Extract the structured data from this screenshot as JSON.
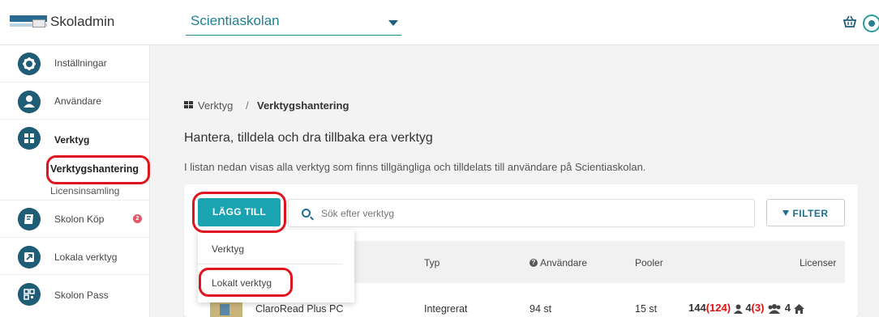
{
  "header": {
    "app_title": "Skoladmin",
    "school_select": "Scientiaskolan"
  },
  "sidebar": {
    "items": [
      {
        "label": "Inställningar",
        "icon": "gear-icon"
      },
      {
        "label": "Användare",
        "icon": "user-icon"
      },
      {
        "label": "Verktyg",
        "icon": "grid-icon"
      },
      {
        "label": "Skolon Köp",
        "icon": "book-icon",
        "badge": "2"
      },
      {
        "label": "Lokala verktyg",
        "icon": "external-link-icon"
      },
      {
        "label": "Skolon Pass",
        "icon": "qr-icon"
      }
    ],
    "subitems": [
      "Verktygshantering",
      "Licensinsamling"
    ]
  },
  "breadcrumb": {
    "parent": "Verktyg",
    "separator": "/",
    "current": "Verktygshantering"
  },
  "main": {
    "heading": "Hantera, tilldela och dra tillbaka era verktyg",
    "description": "I listan nedan visas alla verktyg som finns tillgängliga och tilldelats till användare på Scientiaskolan."
  },
  "toolbar": {
    "add_label": "LÄGG TILL",
    "search_placeholder": "Sök efter verktyg",
    "filter_label": "FILTER"
  },
  "dropdown": {
    "items": [
      "Verktyg",
      "Lokalt verktyg"
    ]
  },
  "table": {
    "columns": [
      "Typ",
      "Användare",
      "Pooler",
      "Licenser"
    ],
    "rows": [
      {
        "name": "ClaroRead Plus PC",
        "type": "Integrerat",
        "users": "94 st",
        "pools": "15 st",
        "lic_total": "144",
        "lic_total_paren": "(124)",
        "lic_user": "4",
        "lic_user_paren": "(3)",
        "lic_group": "4"
      }
    ]
  },
  "colors": {
    "primary": "#1aa3b1",
    "nav": "#1f5c75",
    "annotation": "#e0141e",
    "badge": "#e05a6a"
  }
}
